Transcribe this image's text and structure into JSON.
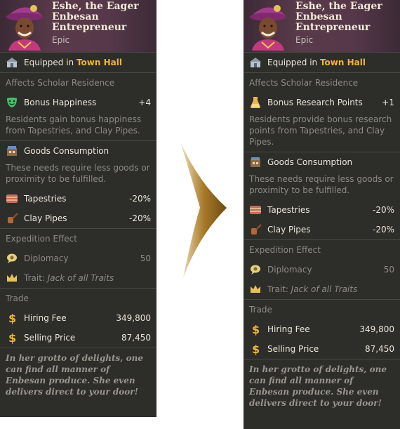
{
  "left": {
    "title": "Eshe, the Eager Enbesan Entrepreneur",
    "rarity": "Epic",
    "equipped_prefix": "Equipped in",
    "equipped_building": "Town Hall",
    "affects": "Affects Scholar Residence",
    "bonus_label": "Bonus Happiness",
    "bonus_value": "+4",
    "bonus_desc": "Residents gain bonus happiness from Tapestries, and Clay Pipes.",
    "goods_title": "Goods Consumption",
    "goods_desc": "These needs require less goods or proximity to be fulfilled.",
    "tapestries_label": "Tapestries",
    "tapestries_value": "-20%",
    "pipes_label": "Clay Pipes",
    "pipes_value": "-20%",
    "expedition_heading": "Expedition Effect",
    "diplomacy_label": "Diplomacy",
    "diplomacy_value": "50",
    "trait_label": "Trait:",
    "trait_value": "Jack of all Traits",
    "trade_heading": "Trade",
    "hiring_label": "Hiring Fee",
    "hiring_value": "349,800",
    "selling_label": "Selling Price",
    "selling_value": "87,450",
    "flavor": "In her grotto of delights, one can find all manner of Enbesan produce. She even delivers direct to your door!"
  },
  "right": {
    "title": "Eshe, the Eager Enbesan Entrepreneur",
    "rarity": "Epic",
    "equipped_prefix": "Equipped in",
    "equipped_building": "Town Hall",
    "affects": "Affects Scholar Residence",
    "bonus_label": "Bonus Research Points",
    "bonus_value": "+1",
    "bonus_desc": "Residents provide bonus research points from Tapestries, and Clay Pipes.",
    "goods_title": "Goods Consumption",
    "goods_desc": "These needs require less goods or proximity to be fulfilled.",
    "tapestries_label": "Tapestries",
    "tapestries_value": "-20%",
    "pipes_label": "Clay Pipes",
    "pipes_value": "-20%",
    "expedition_heading": "Expedition Effect",
    "diplomacy_label": "Diplomacy",
    "diplomacy_value": "50",
    "trait_label": "Trait:",
    "trait_value": "Jack of all Traits",
    "trade_heading": "Trade",
    "hiring_label": "Hiring Fee",
    "hiring_value": "349,800",
    "selling_label": "Selling Price",
    "selling_value": "87,450",
    "flavor": "In her grotto of delights, one can find all manner of Enbesan produce. She even delivers direct to your door!"
  },
  "colors": {
    "panel": "#2d2d2a",
    "accent": "#f0b43a",
    "header": "#55384a",
    "muted": "#8f8b84"
  }
}
